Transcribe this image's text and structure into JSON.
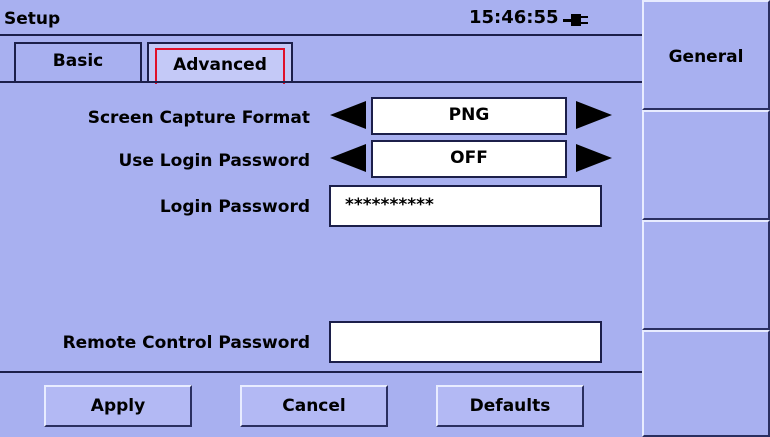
{
  "header": {
    "title": "Setup",
    "time": "15:46:55"
  },
  "tabs": [
    {
      "label": "Basic",
      "selected": false
    },
    {
      "label": "Advanced",
      "selected": true
    }
  ],
  "settings": {
    "screen_capture_format": {
      "label": "Screen Capture Format",
      "value": "PNG"
    },
    "use_login_password": {
      "label": "Use Login Password",
      "value": "OFF"
    },
    "login_password": {
      "label": "Login Password",
      "value": "**********"
    },
    "remote_control_password": {
      "label": "Remote Control Password",
      "value": ""
    }
  },
  "buttons": {
    "apply": "Apply",
    "cancel": "Cancel",
    "defaults": "Defaults"
  },
  "softkeys": [
    "General",
    "",
    "",
    ""
  ],
  "icons": {
    "power": "ac-plug-icon",
    "left": "left-arrow-icon",
    "right": "right-arrow-icon"
  },
  "colors": {
    "background": "#a8b0f0",
    "field": "#ffffff",
    "selected_tab_outline": "#e0102a"
  }
}
